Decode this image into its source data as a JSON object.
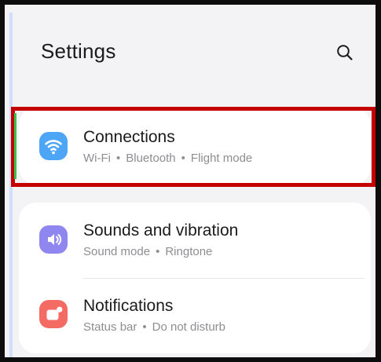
{
  "header": {
    "title": "Settings"
  },
  "icons": {
    "search": "search-icon",
    "connections": "wifi-icon",
    "sounds": "volume-icon",
    "notifications": "notifications-icon"
  },
  "colors": {
    "connections_icon": "#4da6f5",
    "sounds_icon": "#8f86f0",
    "notifications_icon": "#f46b63",
    "highlight_border": "#c40000"
  },
  "items": [
    {
      "title": "Connections",
      "subtitle_parts": [
        "Wi-Fi",
        "Bluetooth",
        "Flight mode"
      ]
    },
    {
      "title": "Sounds and vibration",
      "subtitle_parts": [
        "Sound mode",
        "Ringtone"
      ]
    },
    {
      "title": "Notifications",
      "subtitle_parts": [
        "Status bar",
        "Do not disturb"
      ]
    }
  ],
  "separator": "•"
}
